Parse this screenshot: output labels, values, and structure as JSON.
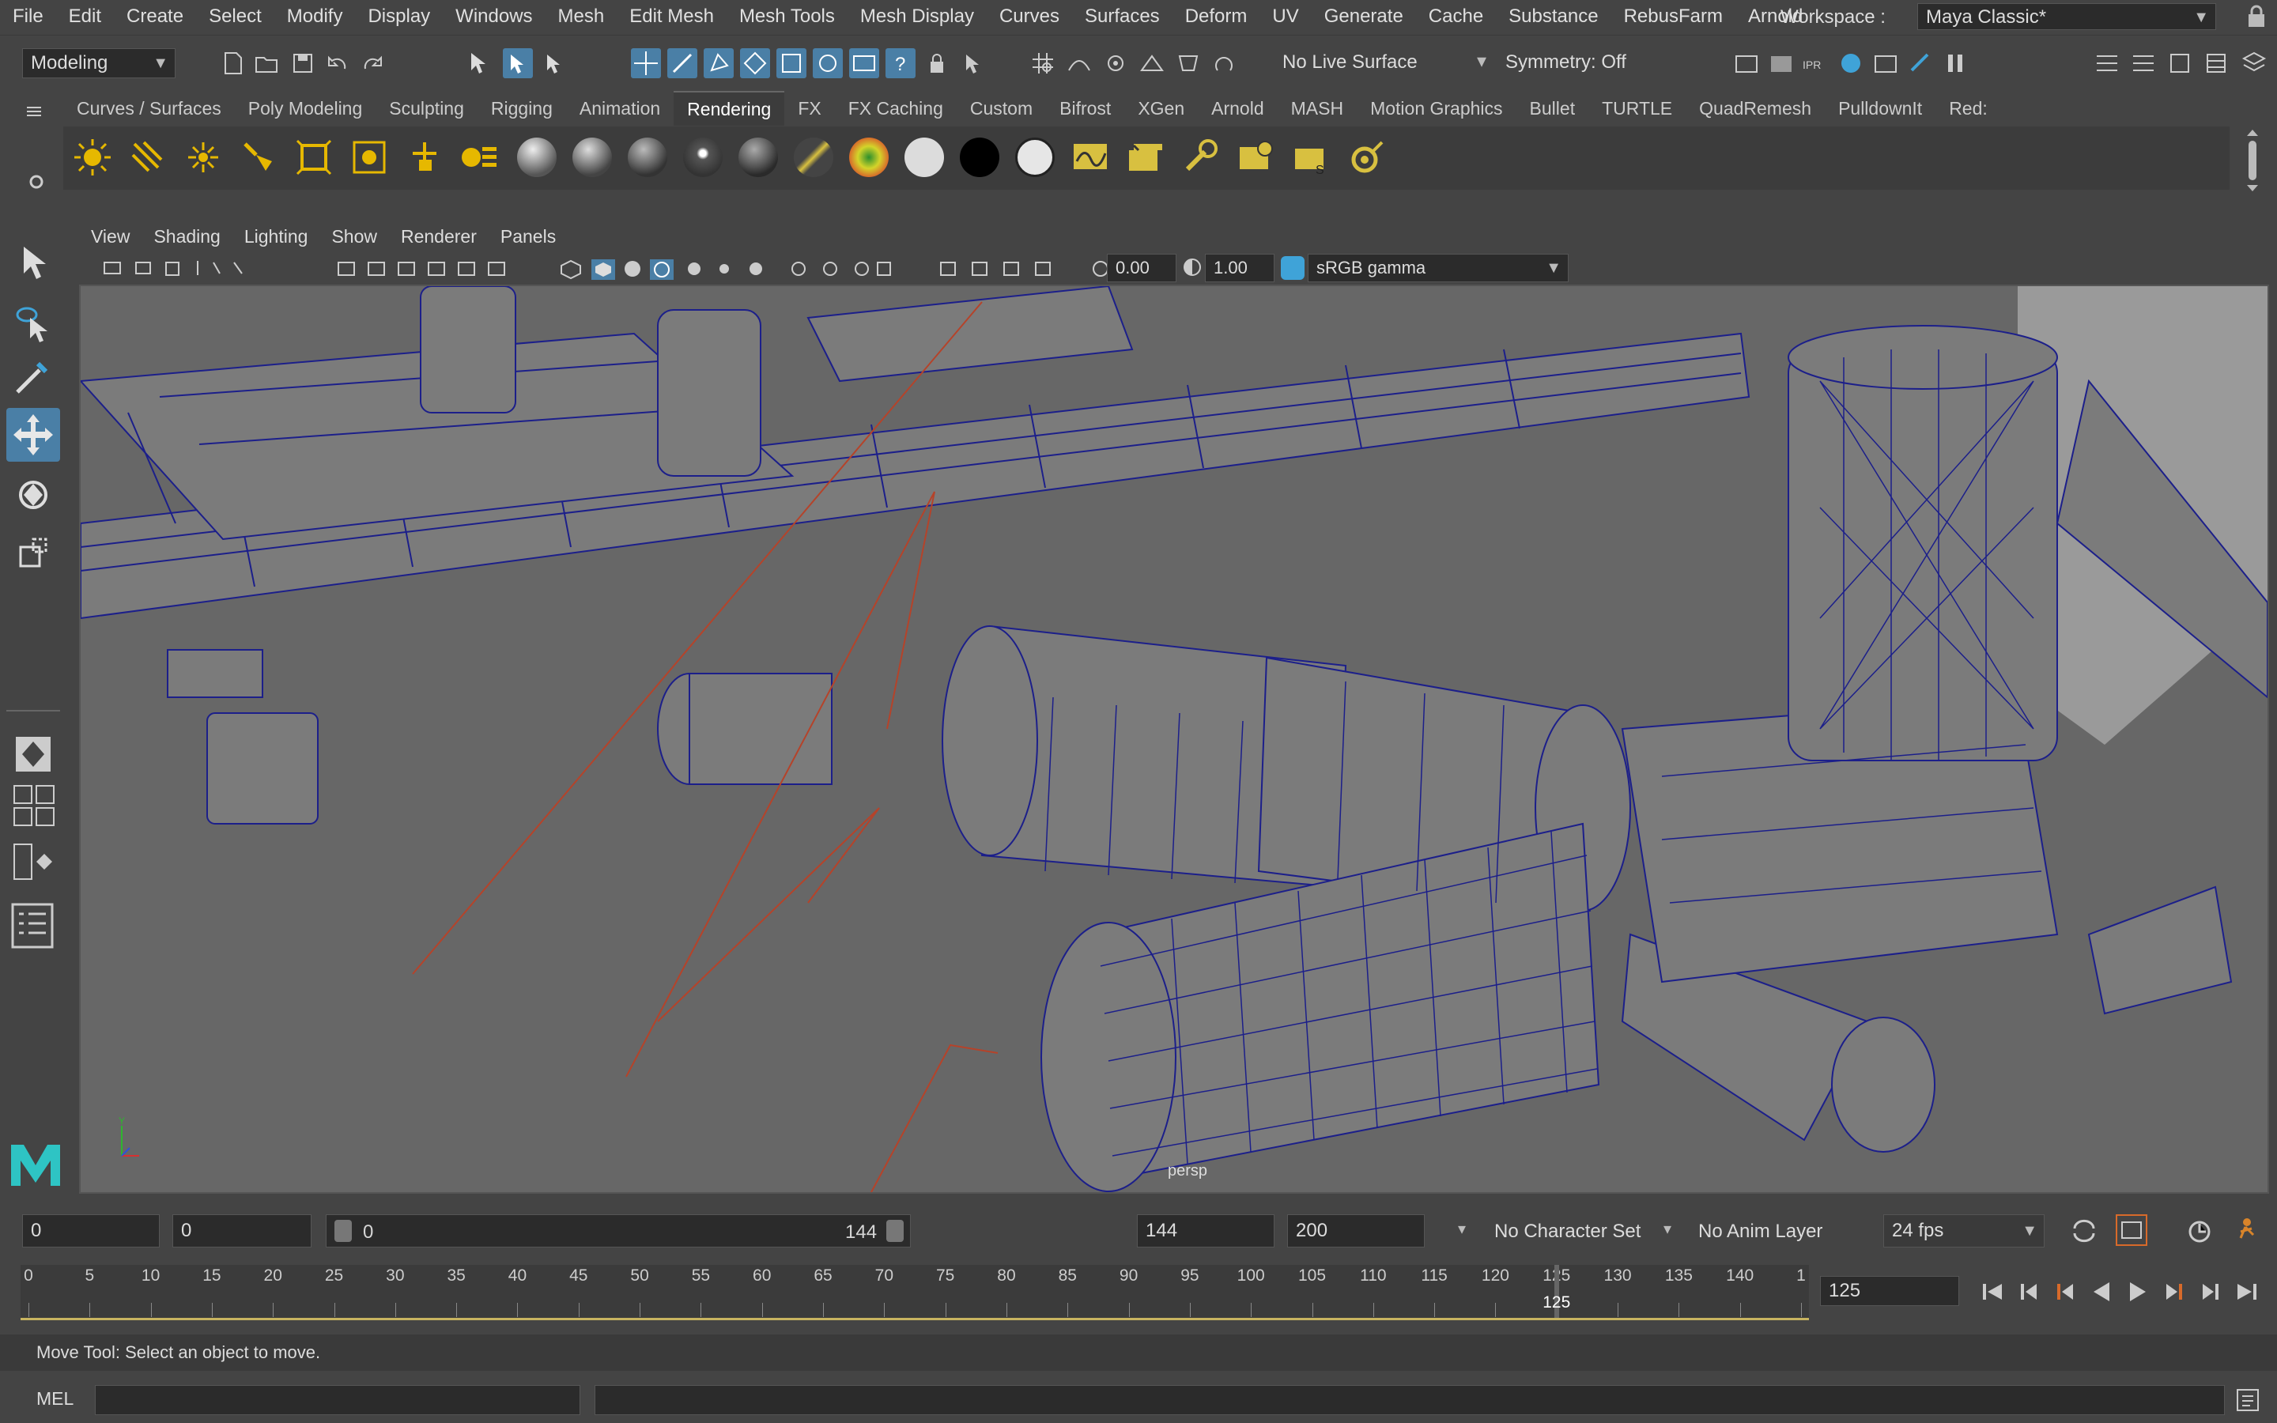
{
  "menubar": {
    "items": [
      "File",
      "Edit",
      "Create",
      "Select",
      "Modify",
      "Display",
      "Windows",
      "Mesh",
      "Edit Mesh",
      "Mesh Tools",
      "Mesh Display",
      "Curves",
      "Surfaces",
      "Deform",
      "UV",
      "Generate",
      "Cache",
      "Substance",
      "RebusFarm",
      "Arnold"
    ],
    "workspace_label": "Workspace :",
    "workspace_value": "Maya Classic*"
  },
  "statusline": {
    "mode": "Modeling",
    "live_surface": "No Live Surface",
    "symmetry": "Symmetry: Off"
  },
  "shelf": {
    "tabs": [
      "Curves / Surfaces",
      "Poly Modeling",
      "Sculpting",
      "Rigging",
      "Animation",
      "Rendering",
      "FX",
      "FX Caching",
      "Custom",
      "Bifrost",
      "XGen",
      "Arnold",
      "MASH",
      "Motion Graphics",
      "Bullet",
      "TURTLE",
      "QuadRemesh",
      "PulldownIt",
      "Red:"
    ],
    "active_tab": "Rendering"
  },
  "panel": {
    "menu": [
      "View",
      "Shading",
      "Lighting",
      "Show",
      "Renderer",
      "Panels"
    ],
    "exposure": "0.00",
    "gamma": "1.00",
    "color_space": "sRGB gamma",
    "camera_label": "persp"
  },
  "range": {
    "start": "0",
    "anim_start": "0",
    "slider_start": "0",
    "slider_end": "144",
    "anim_end": "144",
    "end": "200",
    "character_set": "No Character Set",
    "anim_layer": "No Anim Layer",
    "fps": "24 fps"
  },
  "timeline": {
    "ticks": [
      "0",
      "5",
      "10",
      "15",
      "20",
      "25",
      "30",
      "35",
      "40",
      "45",
      "50",
      "55",
      "60",
      "65",
      "70",
      "75",
      "80",
      "85",
      "90",
      "95",
      "100",
      "105",
      "110",
      "115",
      "120",
      "125",
      "130",
      "135",
      "140",
      "1"
    ],
    "current_frame": "125",
    "current_frame_field": "125"
  },
  "help_line": "Move Tool: Select an object to move.",
  "command_line": {
    "language": "MEL"
  },
  "colors": {
    "accent": "#4a7fa6",
    "wire": "#1c1f8a",
    "viewport_bg": "#6a6a6a"
  }
}
